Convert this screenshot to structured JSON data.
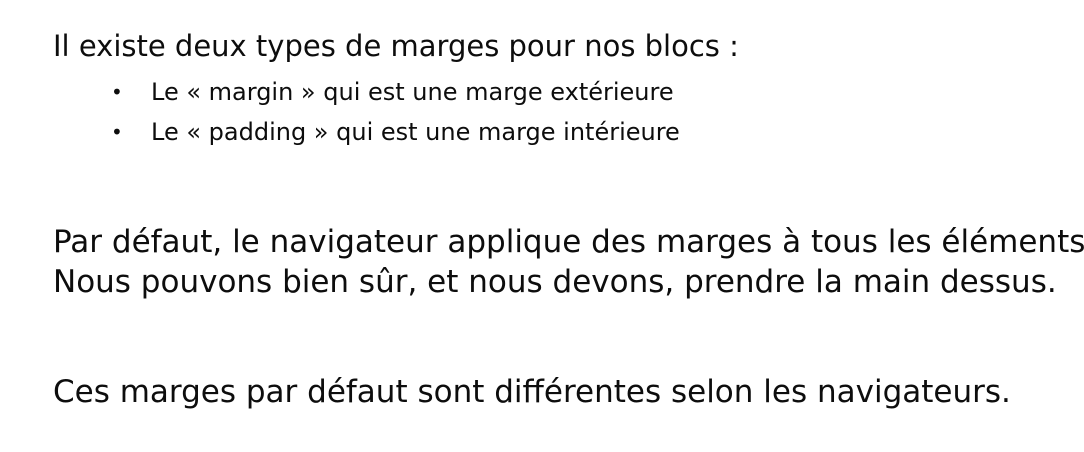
{
  "intro": "Il existe deux types de marges pour nos blocs :",
  "bullets": [
    {
      "marker": "•",
      "text": "Le « margin » qui est une marge extérieure"
    },
    {
      "marker": "•",
      "text": "Le « padding » qui est une marge intérieure"
    }
  ],
  "paragraphs": [
    {
      "lines": [
        "Par défaut, le navigateur applique des marges à tous les éléments.",
        "Nous pouvons bien sûr, et nous devons, prendre la main dessus."
      ]
    },
    {
      "lines": [
        "Ces marges par défaut sont différentes selon les navigateurs."
      ]
    }
  ]
}
